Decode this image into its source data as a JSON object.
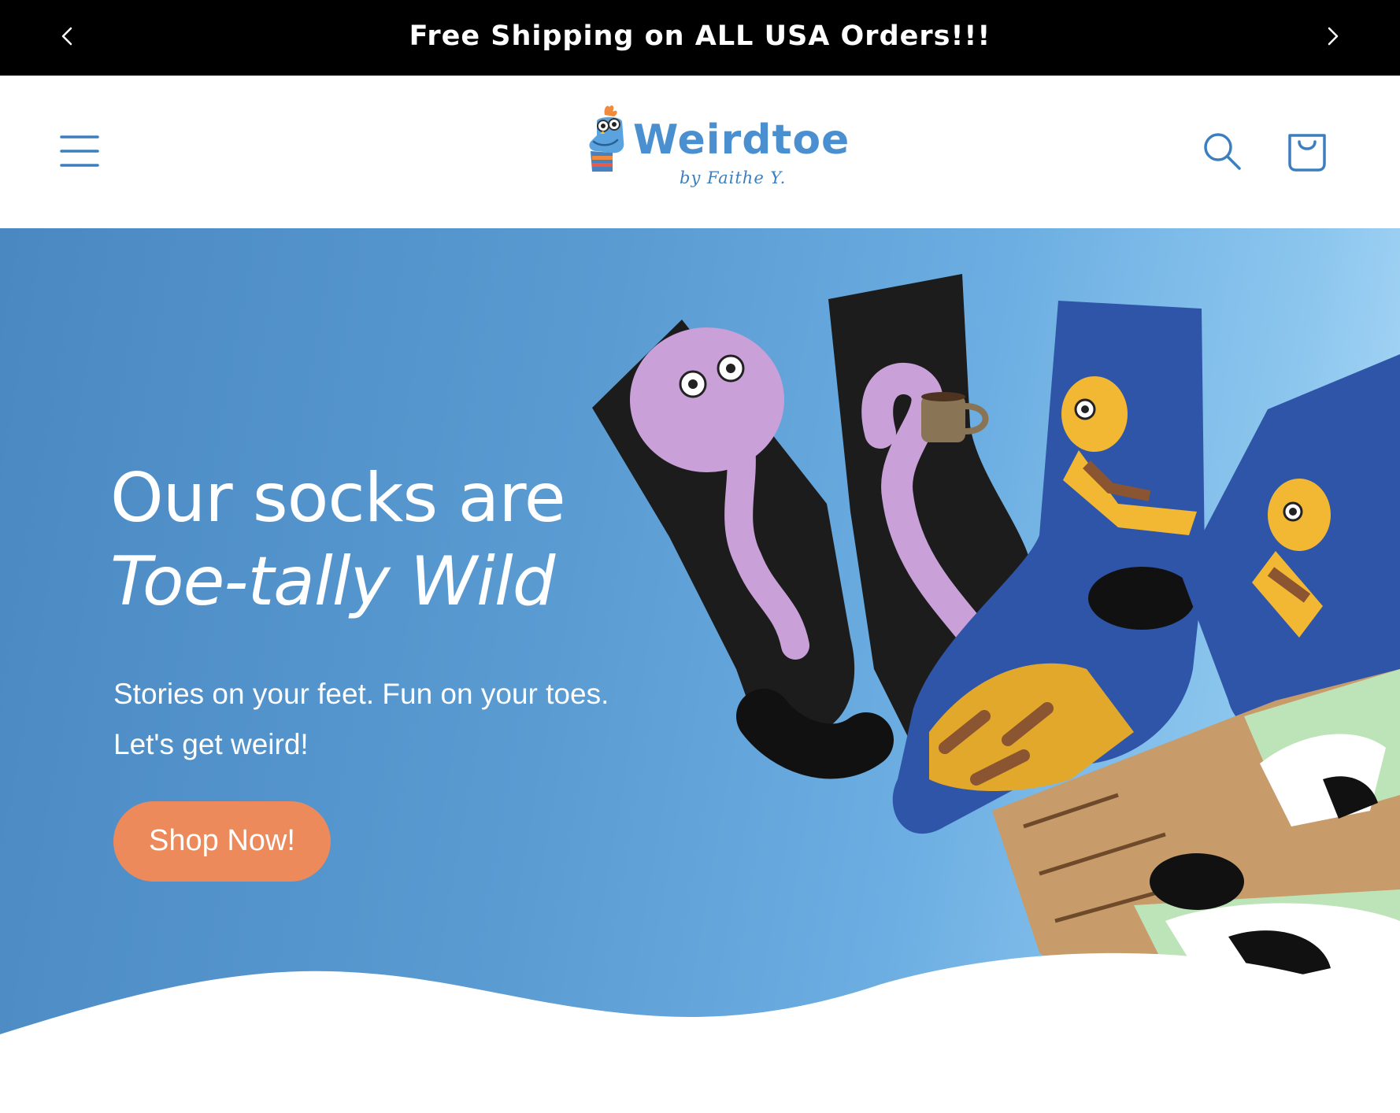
{
  "announcement": {
    "text": "Free Shipping on ALL USA Orders!!!",
    "prev_icon": "chevron-left-icon",
    "next_icon": "chevron-right-icon"
  },
  "header": {
    "menu_icon": "hamburger-menu-icon",
    "logo": {
      "name": "Weirdtoe",
      "tagline": "by Faithe Y."
    },
    "search_icon": "search-icon",
    "cart_icon": "shopping-bag-icon"
  },
  "hero": {
    "title_line1": "Our socks are",
    "title_line2": "Toe-tally Wild",
    "subtitle_line1": "Stories on your feet. Fun on your toes.",
    "subtitle_line2": "Let's get weird!",
    "cta_label": "Shop Now!"
  },
  "colors": {
    "announcement_bg": "#000000",
    "brand_blue": "#4a8fcf",
    "hero_gradient_start": "#4a88c2",
    "hero_gradient_end": "#b8e0fa",
    "cta_bg": "#ec8a5c"
  }
}
